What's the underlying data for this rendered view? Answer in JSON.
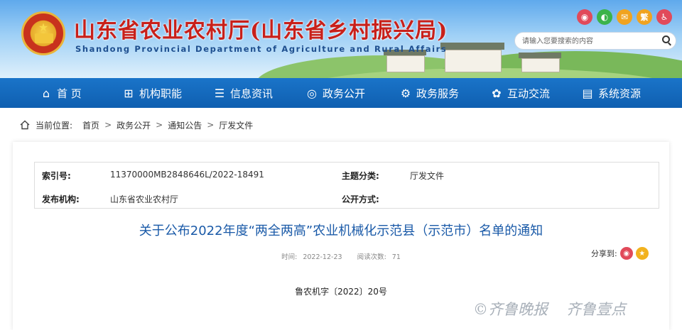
{
  "header": {
    "site_title": "山东省农业农村厅(山东省乡村振兴局)",
    "site_subtitle": "Shandong Provincial Department of Agriculture and Rural Affairs",
    "top_icons": [
      "weibo-icon",
      "wechat-icon",
      "mail-icon",
      "繁",
      "accessibility-icon"
    ],
    "traditional_label": "繁",
    "search_placeholder": "请输入您要搜索的内容"
  },
  "nav": {
    "items": [
      {
        "label": "首 页",
        "icon": "home-icon"
      },
      {
        "label": "机构职能",
        "icon": "org-icon"
      },
      {
        "label": "信息资讯",
        "icon": "doc-icon"
      },
      {
        "label": "政务公开",
        "icon": "eye-icon"
      },
      {
        "label": "政务服务",
        "icon": "gear-icon"
      },
      {
        "label": "互动交流",
        "icon": "chat-icon"
      },
      {
        "label": "系统资源",
        "icon": "resource-icon"
      }
    ]
  },
  "breadcrumb": {
    "label": "当前位置:",
    "items": [
      "首页",
      "政务公开",
      "通知公告",
      "厅发文件"
    ]
  },
  "meta": {
    "index_label": "索引号:",
    "index_value": "11370000MB2848646L/2022-18491",
    "category_label": "主题分类:",
    "category_value": "厅发文件",
    "publisher_label": "发布机构:",
    "publisher_value": "山东省农业农村厅",
    "disclosure_label": "公开方式:",
    "disclosure_value": ""
  },
  "article": {
    "title": "关于公布2022年度“两全两高”农业机械化示范县（示范市）名单的通知",
    "time_label": "时间:",
    "time_value": "2022-12-23",
    "views_label": "阅读次数:",
    "views_value": "71",
    "share_label": "分享到:",
    "doc_number": "鲁农机字〔2022〕20号"
  },
  "watermark": {
    "left": "©齐鲁晚报",
    "right": "齐鲁壹点"
  },
  "colors": {
    "title_red": "#c8201a",
    "nav_blue": "#1569be",
    "link_blue": "#1a5aa8"
  }
}
